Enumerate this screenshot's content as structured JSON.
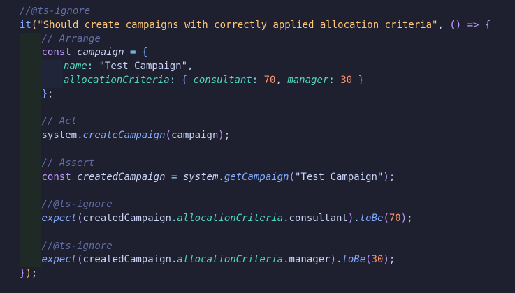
{
  "editor": {
    "lines": [
      {
        "indent": 0,
        "tokens": [
          {
            "t": "//@ts-ignore",
            "c": "c"
          }
        ]
      },
      {
        "indent": 0,
        "tokens": [
          {
            "t": "it",
            "c": "fn"
          },
          {
            "t": "(",
            "c": "br1"
          },
          {
            "t": "\"Should create campaigns with correctly applied allocation criteria\"",
            "c": "str"
          },
          {
            "t": ", ",
            "c": "plain"
          },
          {
            "t": "()",
            "c": "br2"
          },
          {
            "t": " => ",
            "c": "kw"
          },
          {
            "t": "{",
            "c": "br2"
          }
        ]
      },
      {
        "indent": 1,
        "tokens": [
          {
            "t": "// Arrange",
            "c": "c"
          }
        ]
      },
      {
        "indent": 1,
        "tokens": [
          {
            "t": "const ",
            "c": "kw"
          },
          {
            "t": "campaign",
            "c": "vi"
          },
          {
            "t": " = ",
            "c": "op"
          },
          {
            "t": "{",
            "c": "br3"
          }
        ]
      },
      {
        "indent": 2,
        "tokens": [
          {
            "t": "name",
            "c": "prop"
          },
          {
            "t": ": ",
            "c": "op"
          },
          {
            "t": "\"Test Campaign\"",
            "c": "plain"
          },
          {
            "t": ",",
            "c": "plain"
          }
        ]
      },
      {
        "indent": 2,
        "tokens": [
          {
            "t": "allocationCriteria",
            "c": "prop"
          },
          {
            "t": ": ",
            "c": "op"
          },
          {
            "t": "{ ",
            "c": "br3"
          },
          {
            "t": "consultant",
            "c": "prop"
          },
          {
            "t": ": ",
            "c": "op"
          },
          {
            "t": "70",
            "c": "num"
          },
          {
            "t": ", ",
            "c": "plain"
          },
          {
            "t": "manager",
            "c": "prop"
          },
          {
            "t": ": ",
            "c": "op"
          },
          {
            "t": "30",
            "c": "num"
          },
          {
            "t": " }",
            "c": "br3"
          }
        ]
      },
      {
        "indent": 1,
        "tokens": [
          {
            "t": "}",
            "c": "br3"
          },
          {
            "t": ";",
            "c": "plain"
          }
        ]
      },
      {
        "indent": 1,
        "tokens": []
      },
      {
        "indent": 1,
        "tokens": [
          {
            "t": "// Act",
            "c": "c"
          }
        ]
      },
      {
        "indent": 1,
        "tokens": [
          {
            "t": "system",
            "c": "plain"
          },
          {
            "t": ".",
            "c": "op"
          },
          {
            "t": "createCampaign",
            "c": "fi"
          },
          {
            "t": "(",
            "c": "br2"
          },
          {
            "t": "campaign",
            "c": "plain"
          },
          {
            "t": ")",
            "c": "br2"
          },
          {
            "t": ";",
            "c": "plain"
          }
        ]
      },
      {
        "indent": 1,
        "tokens": []
      },
      {
        "indent": 1,
        "tokens": [
          {
            "t": "// Assert",
            "c": "c"
          }
        ]
      },
      {
        "indent": 1,
        "tokens": [
          {
            "t": "const ",
            "c": "kw"
          },
          {
            "t": "createdCampaign",
            "c": "vi"
          },
          {
            "t": " = ",
            "c": "op"
          },
          {
            "t": "system",
            "c": "vi"
          },
          {
            "t": ".",
            "c": "op"
          },
          {
            "t": "getCampaign",
            "c": "fi"
          },
          {
            "t": "(",
            "c": "br2"
          },
          {
            "t": "\"Test Campaign\"",
            "c": "plain"
          },
          {
            "t": ")",
            "c": "br2"
          },
          {
            "t": ";",
            "c": "plain"
          }
        ]
      },
      {
        "indent": 1,
        "tokens": []
      },
      {
        "indent": 1,
        "tokens": [
          {
            "t": "//@ts-ignore",
            "c": "c"
          }
        ]
      },
      {
        "indent": 1,
        "tokens": [
          {
            "t": "expect",
            "c": "fi"
          },
          {
            "t": "(",
            "c": "br2"
          },
          {
            "t": "createdCampaign",
            "c": "plain"
          },
          {
            "t": ".",
            "c": "op"
          },
          {
            "t": "allocationCriteria",
            "c": "prop"
          },
          {
            "t": ".",
            "c": "op"
          },
          {
            "t": "consultant",
            "c": "plain"
          },
          {
            "t": ")",
            "c": "br2"
          },
          {
            "t": ".",
            "c": "op"
          },
          {
            "t": "toBe",
            "c": "fi"
          },
          {
            "t": "(",
            "c": "br2"
          },
          {
            "t": "70",
            "c": "num"
          },
          {
            "t": ")",
            "c": "br2"
          },
          {
            "t": ";",
            "c": "plain"
          }
        ]
      },
      {
        "indent": 1,
        "tokens": []
      },
      {
        "indent": 1,
        "tokens": [
          {
            "t": "//@ts-ignore",
            "c": "c"
          }
        ]
      },
      {
        "indent": 1,
        "tokens": [
          {
            "t": "expect",
            "c": "fi"
          },
          {
            "t": "(",
            "c": "br2"
          },
          {
            "t": "createdCampaign",
            "c": "plain"
          },
          {
            "t": ".",
            "c": "op"
          },
          {
            "t": "allocationCriteria",
            "c": "prop"
          },
          {
            "t": ".",
            "c": "op"
          },
          {
            "t": "manager",
            "c": "plain"
          },
          {
            "t": ")",
            "c": "br2"
          },
          {
            "t": ".",
            "c": "op"
          },
          {
            "t": "toBe",
            "c": "fi"
          },
          {
            "t": "(",
            "c": "br2"
          },
          {
            "t": "30",
            "c": "num"
          },
          {
            "t": ")",
            "c": "br2"
          },
          {
            "t": ";",
            "c": "plain"
          }
        ]
      },
      {
        "indent": 0,
        "tokens": [
          {
            "t": "}",
            "c": "br2"
          },
          {
            "t": ")",
            "c": "br1"
          },
          {
            "t": ";",
            "c": "plain"
          }
        ]
      }
    ]
  }
}
